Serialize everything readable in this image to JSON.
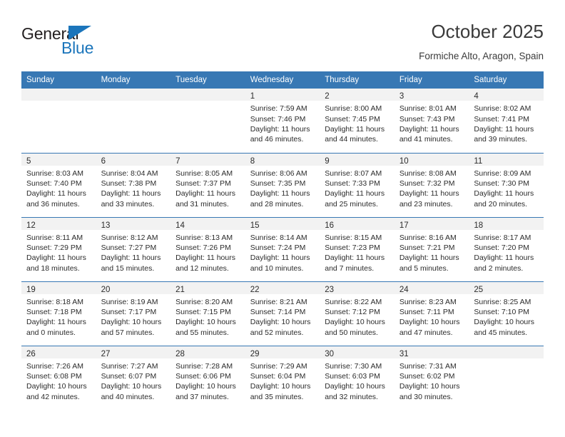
{
  "brand": {
    "name_top": "General",
    "name_bottom": "Blue",
    "triangle_icon": "brand-triangle-icon",
    "accent_color": "#1b75bb"
  },
  "header": {
    "title": "October 2025",
    "subtitle": "Formiche Alto, Aragon, Spain"
  },
  "theme": {
    "header_blue": "#3878b4",
    "band_gray": "#f2f2f2",
    "text": "#2b2b2b"
  },
  "calendar": {
    "weekday_headers": [
      "Sunday",
      "Monday",
      "Tuesday",
      "Wednesday",
      "Thursday",
      "Friday",
      "Saturday"
    ],
    "weeks": [
      [
        {
          "empty": true
        },
        {
          "empty": true
        },
        {
          "empty": true
        },
        {
          "day": "1",
          "sunrise": "Sunrise: 7:59 AM",
          "sunset": "Sunset: 7:46 PM",
          "daylight_1": "Daylight: 11 hours",
          "daylight_2": "and 46 minutes."
        },
        {
          "day": "2",
          "sunrise": "Sunrise: 8:00 AM",
          "sunset": "Sunset: 7:45 PM",
          "daylight_1": "Daylight: 11 hours",
          "daylight_2": "and 44 minutes."
        },
        {
          "day": "3",
          "sunrise": "Sunrise: 8:01 AM",
          "sunset": "Sunset: 7:43 PM",
          "daylight_1": "Daylight: 11 hours",
          "daylight_2": "and 41 minutes."
        },
        {
          "day": "4",
          "sunrise": "Sunrise: 8:02 AM",
          "sunset": "Sunset: 7:41 PM",
          "daylight_1": "Daylight: 11 hours",
          "daylight_2": "and 39 minutes."
        }
      ],
      [
        {
          "day": "5",
          "sunrise": "Sunrise: 8:03 AM",
          "sunset": "Sunset: 7:40 PM",
          "daylight_1": "Daylight: 11 hours",
          "daylight_2": "and 36 minutes."
        },
        {
          "day": "6",
          "sunrise": "Sunrise: 8:04 AM",
          "sunset": "Sunset: 7:38 PM",
          "daylight_1": "Daylight: 11 hours",
          "daylight_2": "and 33 minutes."
        },
        {
          "day": "7",
          "sunrise": "Sunrise: 8:05 AM",
          "sunset": "Sunset: 7:37 PM",
          "daylight_1": "Daylight: 11 hours",
          "daylight_2": "and 31 minutes."
        },
        {
          "day": "8",
          "sunrise": "Sunrise: 8:06 AM",
          "sunset": "Sunset: 7:35 PM",
          "daylight_1": "Daylight: 11 hours",
          "daylight_2": "and 28 minutes."
        },
        {
          "day": "9",
          "sunrise": "Sunrise: 8:07 AM",
          "sunset": "Sunset: 7:33 PM",
          "daylight_1": "Daylight: 11 hours",
          "daylight_2": "and 25 minutes."
        },
        {
          "day": "10",
          "sunrise": "Sunrise: 8:08 AM",
          "sunset": "Sunset: 7:32 PM",
          "daylight_1": "Daylight: 11 hours",
          "daylight_2": "and 23 minutes."
        },
        {
          "day": "11",
          "sunrise": "Sunrise: 8:09 AM",
          "sunset": "Sunset: 7:30 PM",
          "daylight_1": "Daylight: 11 hours",
          "daylight_2": "and 20 minutes."
        }
      ],
      [
        {
          "day": "12",
          "sunrise": "Sunrise: 8:11 AM",
          "sunset": "Sunset: 7:29 PM",
          "daylight_1": "Daylight: 11 hours",
          "daylight_2": "and 18 minutes."
        },
        {
          "day": "13",
          "sunrise": "Sunrise: 8:12 AM",
          "sunset": "Sunset: 7:27 PM",
          "daylight_1": "Daylight: 11 hours",
          "daylight_2": "and 15 minutes."
        },
        {
          "day": "14",
          "sunrise": "Sunrise: 8:13 AM",
          "sunset": "Sunset: 7:26 PM",
          "daylight_1": "Daylight: 11 hours",
          "daylight_2": "and 12 minutes."
        },
        {
          "day": "15",
          "sunrise": "Sunrise: 8:14 AM",
          "sunset": "Sunset: 7:24 PM",
          "daylight_1": "Daylight: 11 hours",
          "daylight_2": "and 10 minutes."
        },
        {
          "day": "16",
          "sunrise": "Sunrise: 8:15 AM",
          "sunset": "Sunset: 7:23 PM",
          "daylight_1": "Daylight: 11 hours",
          "daylight_2": "and 7 minutes."
        },
        {
          "day": "17",
          "sunrise": "Sunrise: 8:16 AM",
          "sunset": "Sunset: 7:21 PM",
          "daylight_1": "Daylight: 11 hours",
          "daylight_2": "and 5 minutes."
        },
        {
          "day": "18",
          "sunrise": "Sunrise: 8:17 AM",
          "sunset": "Sunset: 7:20 PM",
          "daylight_1": "Daylight: 11 hours",
          "daylight_2": "and 2 minutes."
        }
      ],
      [
        {
          "day": "19",
          "sunrise": "Sunrise: 8:18 AM",
          "sunset": "Sunset: 7:18 PM",
          "daylight_1": "Daylight: 11 hours",
          "daylight_2": "and 0 minutes."
        },
        {
          "day": "20",
          "sunrise": "Sunrise: 8:19 AM",
          "sunset": "Sunset: 7:17 PM",
          "daylight_1": "Daylight: 10 hours",
          "daylight_2": "and 57 minutes."
        },
        {
          "day": "21",
          "sunrise": "Sunrise: 8:20 AM",
          "sunset": "Sunset: 7:15 PM",
          "daylight_1": "Daylight: 10 hours",
          "daylight_2": "and 55 minutes."
        },
        {
          "day": "22",
          "sunrise": "Sunrise: 8:21 AM",
          "sunset": "Sunset: 7:14 PM",
          "daylight_1": "Daylight: 10 hours",
          "daylight_2": "and 52 minutes."
        },
        {
          "day": "23",
          "sunrise": "Sunrise: 8:22 AM",
          "sunset": "Sunset: 7:12 PM",
          "daylight_1": "Daylight: 10 hours",
          "daylight_2": "and 50 minutes."
        },
        {
          "day": "24",
          "sunrise": "Sunrise: 8:23 AM",
          "sunset": "Sunset: 7:11 PM",
          "daylight_1": "Daylight: 10 hours",
          "daylight_2": "and 47 minutes."
        },
        {
          "day": "25",
          "sunrise": "Sunrise: 8:25 AM",
          "sunset": "Sunset: 7:10 PM",
          "daylight_1": "Daylight: 10 hours",
          "daylight_2": "and 45 minutes."
        }
      ],
      [
        {
          "day": "26",
          "sunrise": "Sunrise: 7:26 AM",
          "sunset": "Sunset: 6:08 PM",
          "daylight_1": "Daylight: 10 hours",
          "daylight_2": "and 42 minutes."
        },
        {
          "day": "27",
          "sunrise": "Sunrise: 7:27 AM",
          "sunset": "Sunset: 6:07 PM",
          "daylight_1": "Daylight: 10 hours",
          "daylight_2": "and 40 minutes."
        },
        {
          "day": "28",
          "sunrise": "Sunrise: 7:28 AM",
          "sunset": "Sunset: 6:06 PM",
          "daylight_1": "Daylight: 10 hours",
          "daylight_2": "and 37 minutes."
        },
        {
          "day": "29",
          "sunrise": "Sunrise: 7:29 AM",
          "sunset": "Sunset: 6:04 PM",
          "daylight_1": "Daylight: 10 hours",
          "daylight_2": "and 35 minutes."
        },
        {
          "day": "30",
          "sunrise": "Sunrise: 7:30 AM",
          "sunset": "Sunset: 6:03 PM",
          "daylight_1": "Daylight: 10 hours",
          "daylight_2": "and 32 minutes."
        },
        {
          "day": "31",
          "sunrise": "Sunrise: 7:31 AM",
          "sunset": "Sunset: 6:02 PM",
          "daylight_1": "Daylight: 10 hours",
          "daylight_2": "and 30 minutes."
        },
        {
          "empty": true
        }
      ]
    ]
  }
}
